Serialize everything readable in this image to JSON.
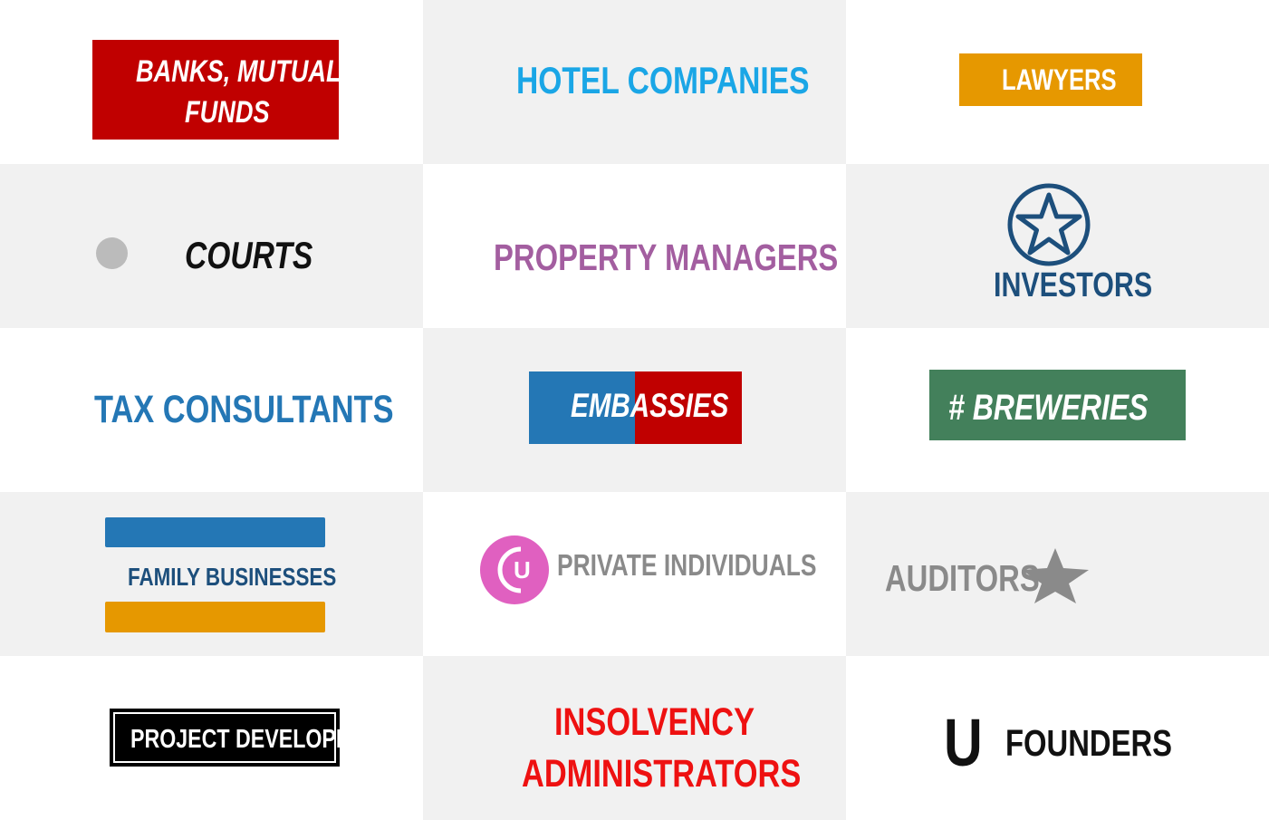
{
  "cells": [
    {
      "label": "BANKS, MUTUAL FUNDS",
      "line1": "BANKS, MUTUAL",
      "line2": "FUNDS",
      "color": "#ffffff",
      "box": "#c00000"
    },
    {
      "label": "HOTEL COMPANIES",
      "color": "#1aa6e6"
    },
    {
      "label": "LAWYERS",
      "color": "#ffffff",
      "box": "#e69800"
    },
    {
      "label": "COURTS",
      "color": "#111111",
      "dot": "#bbbbbb"
    },
    {
      "label": "PROPERTY MANAGERS",
      "color": "#a35ea0"
    },
    {
      "label": "INVESTORS",
      "color": "#1d4f7c",
      "icon": "star-circle-icon"
    },
    {
      "label": "TAX CONSULTANTS",
      "color": "#2477b5"
    },
    {
      "label": "EMBASSIES",
      "color": "#ffffff",
      "box_left": "#2477b5",
      "box_right": "#c00000"
    },
    {
      "label": "# BREWERIES",
      "color": "#ffffff",
      "box": "#43805b"
    },
    {
      "label": "FAMILY BUSINESSES",
      "color": "#1d4f7c",
      "bar_top": "#2477b5",
      "bar_bottom": "#e69800"
    },
    {
      "label": "PRIVATE INDIVIDUALS",
      "color": "#8a8a8a",
      "badge": "#e060c0",
      "badge_letter": "U",
      "icon": "cu-badge-icon"
    },
    {
      "label": "AUDITORS",
      "color": "#8a8a8a",
      "icon": "star-icon"
    },
    {
      "label": "PROJECT DEVELOPERS",
      "color": "#ffffff",
      "box": "#000000"
    },
    {
      "label": "INSOLVENCY ADMINISTRATORS",
      "line1": "INSOLVENCY",
      "line2": "ADMINISTRATORS",
      "color": "#ee1111"
    },
    {
      "label": "FOUNDERS",
      "color": "#111111",
      "letter": "U"
    }
  ]
}
